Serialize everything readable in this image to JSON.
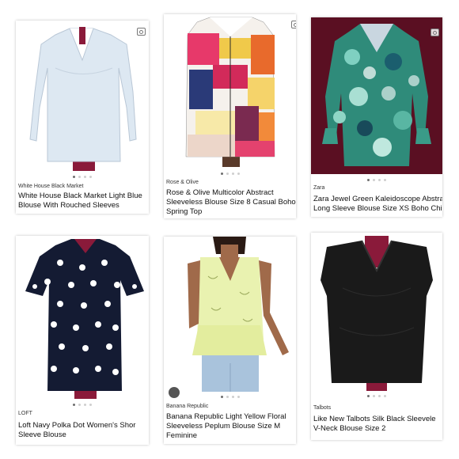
{
  "listings": [
    {
      "brand": "White House Black Market",
      "title_lines": [
        "White House Black Market Light Blue",
        "Blouse With Rouched Sleeves"
      ],
      "image": "light-blue-blouse"
    },
    {
      "brand": "Rose & Olive",
      "title_lines": [
        "Rose & Olive Multicolor Abstract",
        "Sleeveless Blouse Size 8 Casual Boho",
        "Spring Top"
      ],
      "image": "multicolor-abstract-sleeveless-blouse"
    },
    {
      "brand": "Zara",
      "title_lines": [
        "Zara Jewel Green Kaleidoscope Abstra",
        "Long Sleeve Blouse Size XS Boho Chic"
      ],
      "image": "jewel-green-kaleidoscope-blouse"
    },
    {
      "brand": "LOFT",
      "title_lines": [
        "Loft Navy Polka Dot Women's Shor",
        "Sleeve Blouse"
      ],
      "image": "navy-polka-dot-blouse"
    },
    {
      "brand": "Banana Republic",
      "title_lines": [
        "Banana Republic Light Yellow Floral",
        "Sleeveless Peplum Blouse Size M",
        "Feminine"
      ],
      "image": "light-yellow-floral-peplum-blouse"
    },
    {
      "brand": "Talbots",
      "title_lines": [
        "Like New Talbots Silk Black Sleevele",
        "V-Neck Blouse Size 2"
      ],
      "image": "black-silk-sleeveless-blouse"
    }
  ],
  "colors": {
    "mannequin": "#8a1a3a",
    "burgundy_backdrop": "#5a0f22",
    "light_blue": "#dde8f2",
    "navy": "#141b33",
    "yellow": "#e9f2b0",
    "black_silk": "#1a1a1a"
  }
}
